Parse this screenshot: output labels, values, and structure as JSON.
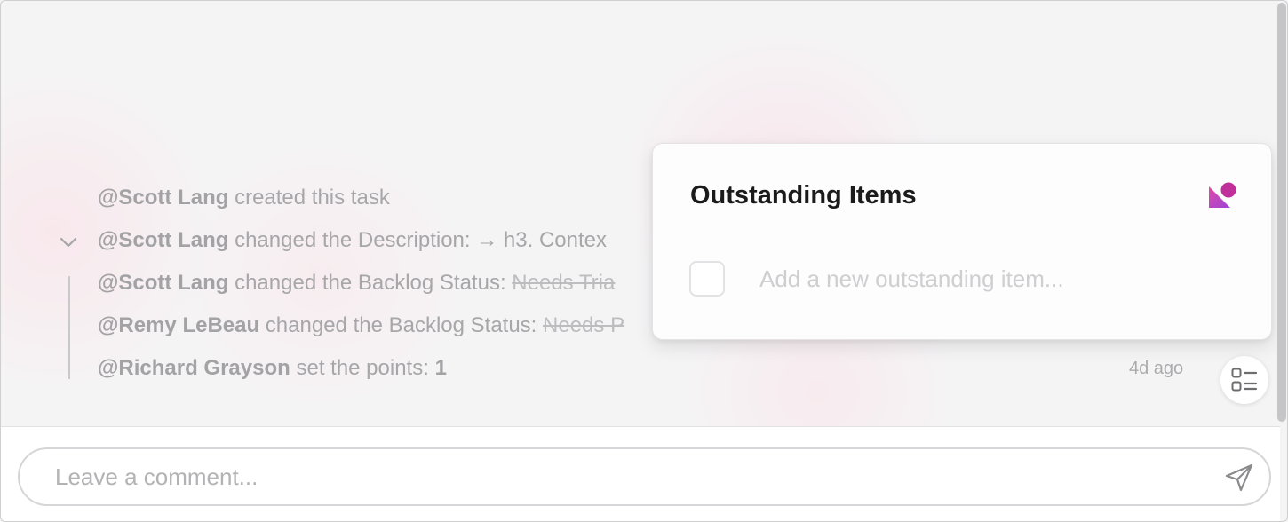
{
  "activity": [
    {
      "user": "@Scott Lang",
      "text": " created this task",
      "old": "",
      "value": ""
    },
    {
      "user": "@Scott Lang",
      "text": " changed the Description:  → h3. Contex",
      "old": "",
      "value": ""
    },
    {
      "user": "@Scott Lang",
      "text": " changed the Backlog Status: ",
      "old": "Needs Tria",
      "value": ""
    },
    {
      "user": "@Remy LeBeau",
      "text": " changed the Backlog Status: ",
      "old": "Needs P",
      "value": ""
    },
    {
      "user": "@Richard Grayson",
      "text": " set the points: ",
      "old": "",
      "value": "1"
    }
  ],
  "timestamp": "4d ago",
  "popover": {
    "title": "Outstanding Items",
    "item_placeholder": "Add a new outstanding item..."
  },
  "comment": {
    "placeholder": "Leave a comment..."
  },
  "colors": {
    "brand_gradient_start": "#e04aa6",
    "brand_gradient_end": "#9b44d8"
  },
  "icons": {
    "expand": "chevron-down-icon",
    "toggle": "checklist-icon",
    "brand": "brand-shape-icon",
    "send": "send-icon"
  }
}
